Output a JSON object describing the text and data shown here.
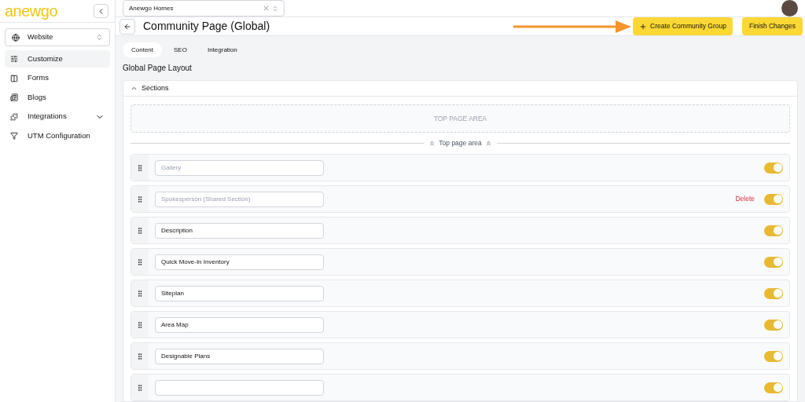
{
  "logo": "anewgo",
  "org_select": {
    "value": "Anewgo Homes"
  },
  "sidebar": {
    "product_select": "Website",
    "items": [
      {
        "label": "Customize",
        "selected": true,
        "kind": "customize"
      },
      {
        "label": "Forms",
        "selected": false,
        "kind": "forms"
      },
      {
        "label": "Blogs",
        "selected": false,
        "kind": "blogs"
      },
      {
        "label": "Integrations",
        "selected": false,
        "kind": "integrations",
        "expandable": true
      },
      {
        "label": "UTM Configuration",
        "selected": false,
        "kind": "utm"
      }
    ]
  },
  "header": {
    "title": "Community Page (Global)",
    "buttons": [
      "Create Community Group",
      "Finish Changes"
    ]
  },
  "tabs": [
    {
      "label": "Content",
      "selected": true
    },
    {
      "label": "SEO",
      "selected": false
    },
    {
      "label": "Integration",
      "selected": false
    }
  ],
  "layout_title": "Global Page Layout",
  "sections": {
    "title": "Sections",
    "expanded": true,
    "top_area": "TOP PAGE AREA",
    "divider_label": "Top page area",
    "rows": [
      {
        "placeholder": "Gallery",
        "on": true
      },
      {
        "placeholder": "Spokesperson (Shared Section)",
        "delete": "Delete",
        "on": true
      },
      {
        "value": "Description",
        "on": true
      },
      {
        "value": "Quick Move-In Inventory",
        "on": true
      },
      {
        "value": "Siteplan",
        "on": true
      },
      {
        "value": "Area Map",
        "on": true
      },
      {
        "value": "Designable Plans",
        "on": true
      },
      {
        "on": true
      }
    ]
  }
}
